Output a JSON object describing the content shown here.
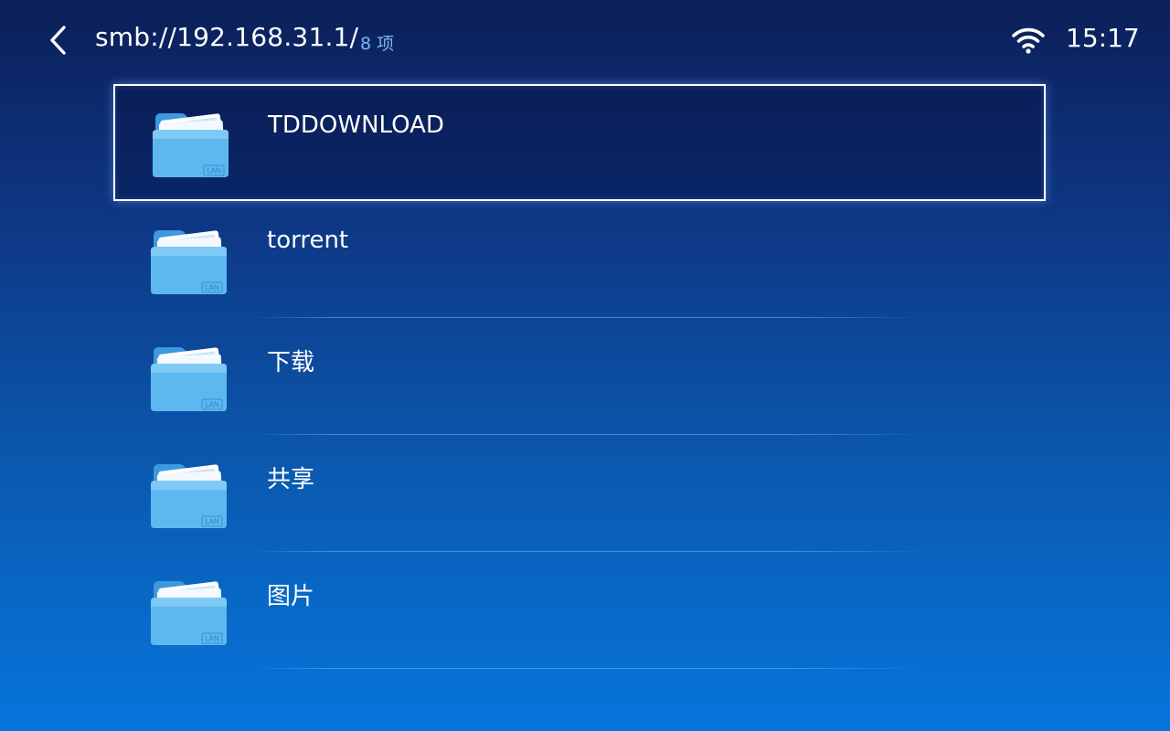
{
  "header": {
    "path": "smb://192.168.31.1/",
    "count": "8 项",
    "time": "15:17"
  },
  "icons": {
    "back": "back-arrow-icon",
    "wifi": "wifi-icon",
    "folder": "lan-folder-icon"
  },
  "folder_badge": "LAN",
  "files": [
    {
      "name": "TDDOWNLOAD",
      "selected": true
    },
    {
      "name": "torrent",
      "selected": false
    },
    {
      "name": "下载",
      "selected": false
    },
    {
      "name": "共享",
      "selected": false
    },
    {
      "name": "图片",
      "selected": false
    }
  ],
  "colors": {
    "background_top": "#0c1f58",
    "background_bottom": "#0676dc",
    "accent_text": "#7fb6f3",
    "folder_blue": "#5db8f0"
  }
}
